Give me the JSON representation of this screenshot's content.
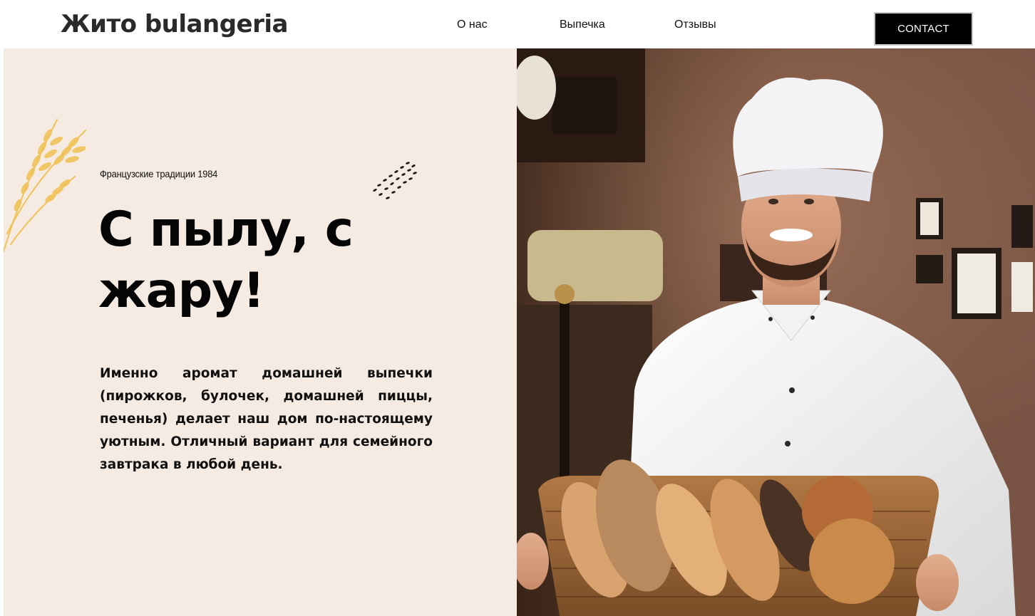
{
  "header": {
    "logo": "Жито bulangeria",
    "nav": {
      "about": "О нас",
      "bakery": "Выпечка",
      "reviews": "Отзывы"
    },
    "contact_button": "CONTACT"
  },
  "hero": {
    "tagline": "Французские традиции 1984",
    "headline": "С пылу, с жару!",
    "description": "Именно аромат домашней выпечки (пирожков, булочек, домашней пиццы, печенья) делает наш дом по-настоящему уютным. Отличный вариант для семейного завтрака в любой день."
  },
  "colors": {
    "panel_background": "#f5ebe2",
    "button_background": "#000000",
    "wheat_accent": "#f0c35a"
  }
}
